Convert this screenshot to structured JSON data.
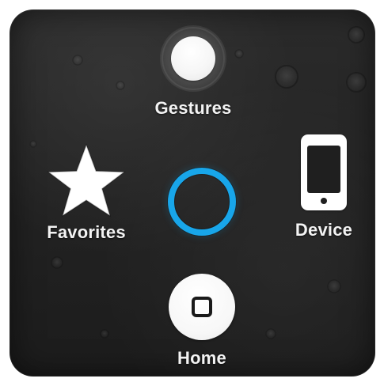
{
  "menu": {
    "items": {
      "gestures": {
        "label": "Gestures",
        "icon": "gestures-icon"
      },
      "favorites": {
        "label": "Favorites",
        "icon": "star-icon"
      },
      "device": {
        "label": "Device",
        "icon": "device-icon"
      },
      "home": {
        "label": "Home",
        "icon": "home-icon"
      }
    },
    "center": {
      "icon": "assistive-touch-ring-icon"
    }
  },
  "colors": {
    "panel_background": "#252525",
    "label_text": "#f3f3f3",
    "accent_ring": "#18a6ea",
    "icon_fill": "#ffffff",
    "icon_dark": "#1a1a1a"
  }
}
